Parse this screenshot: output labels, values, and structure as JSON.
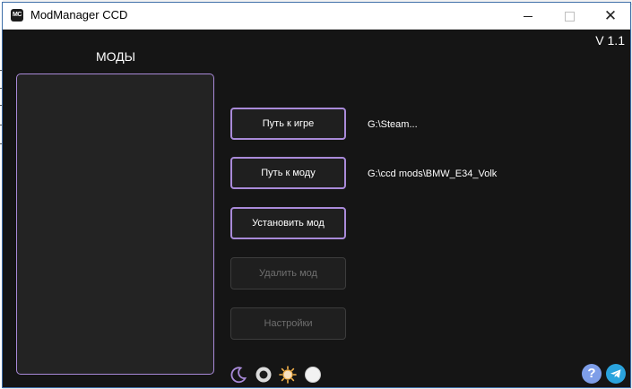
{
  "window": {
    "title": "ModManager CCD",
    "app_icon_text": "MC",
    "controls": {
      "minimize": "minimize",
      "maximize": "maximize",
      "close": "✕"
    }
  },
  "version": "V 1.1",
  "mods_panel": {
    "title": "МОДЫ",
    "items": []
  },
  "buttons": {
    "game_path": "Путь к игре",
    "mod_path": "Путь к моду",
    "install": "Установить мод",
    "delete": "Удалить мод",
    "settings": "Настройки"
  },
  "paths": {
    "game": "G:\\Steam...",
    "mod": "G:\\ccd mods\\BMW_E34_Volk"
  },
  "theme_icons": [
    "moon-icon",
    "dark-radio-icon",
    "sun-icon",
    "light-radio-icon"
  ],
  "corner_icons": {
    "help": "?",
    "telegram": "telegram-icon"
  },
  "colors": {
    "accent": "#a98ad9",
    "window_bg": "#151515",
    "panel_bg": "#232323",
    "help_icon": "#7e9ee8",
    "telegram_icon": "#2aa3dd"
  },
  "states": {
    "delete_enabled": false,
    "settings_enabled": false
  }
}
